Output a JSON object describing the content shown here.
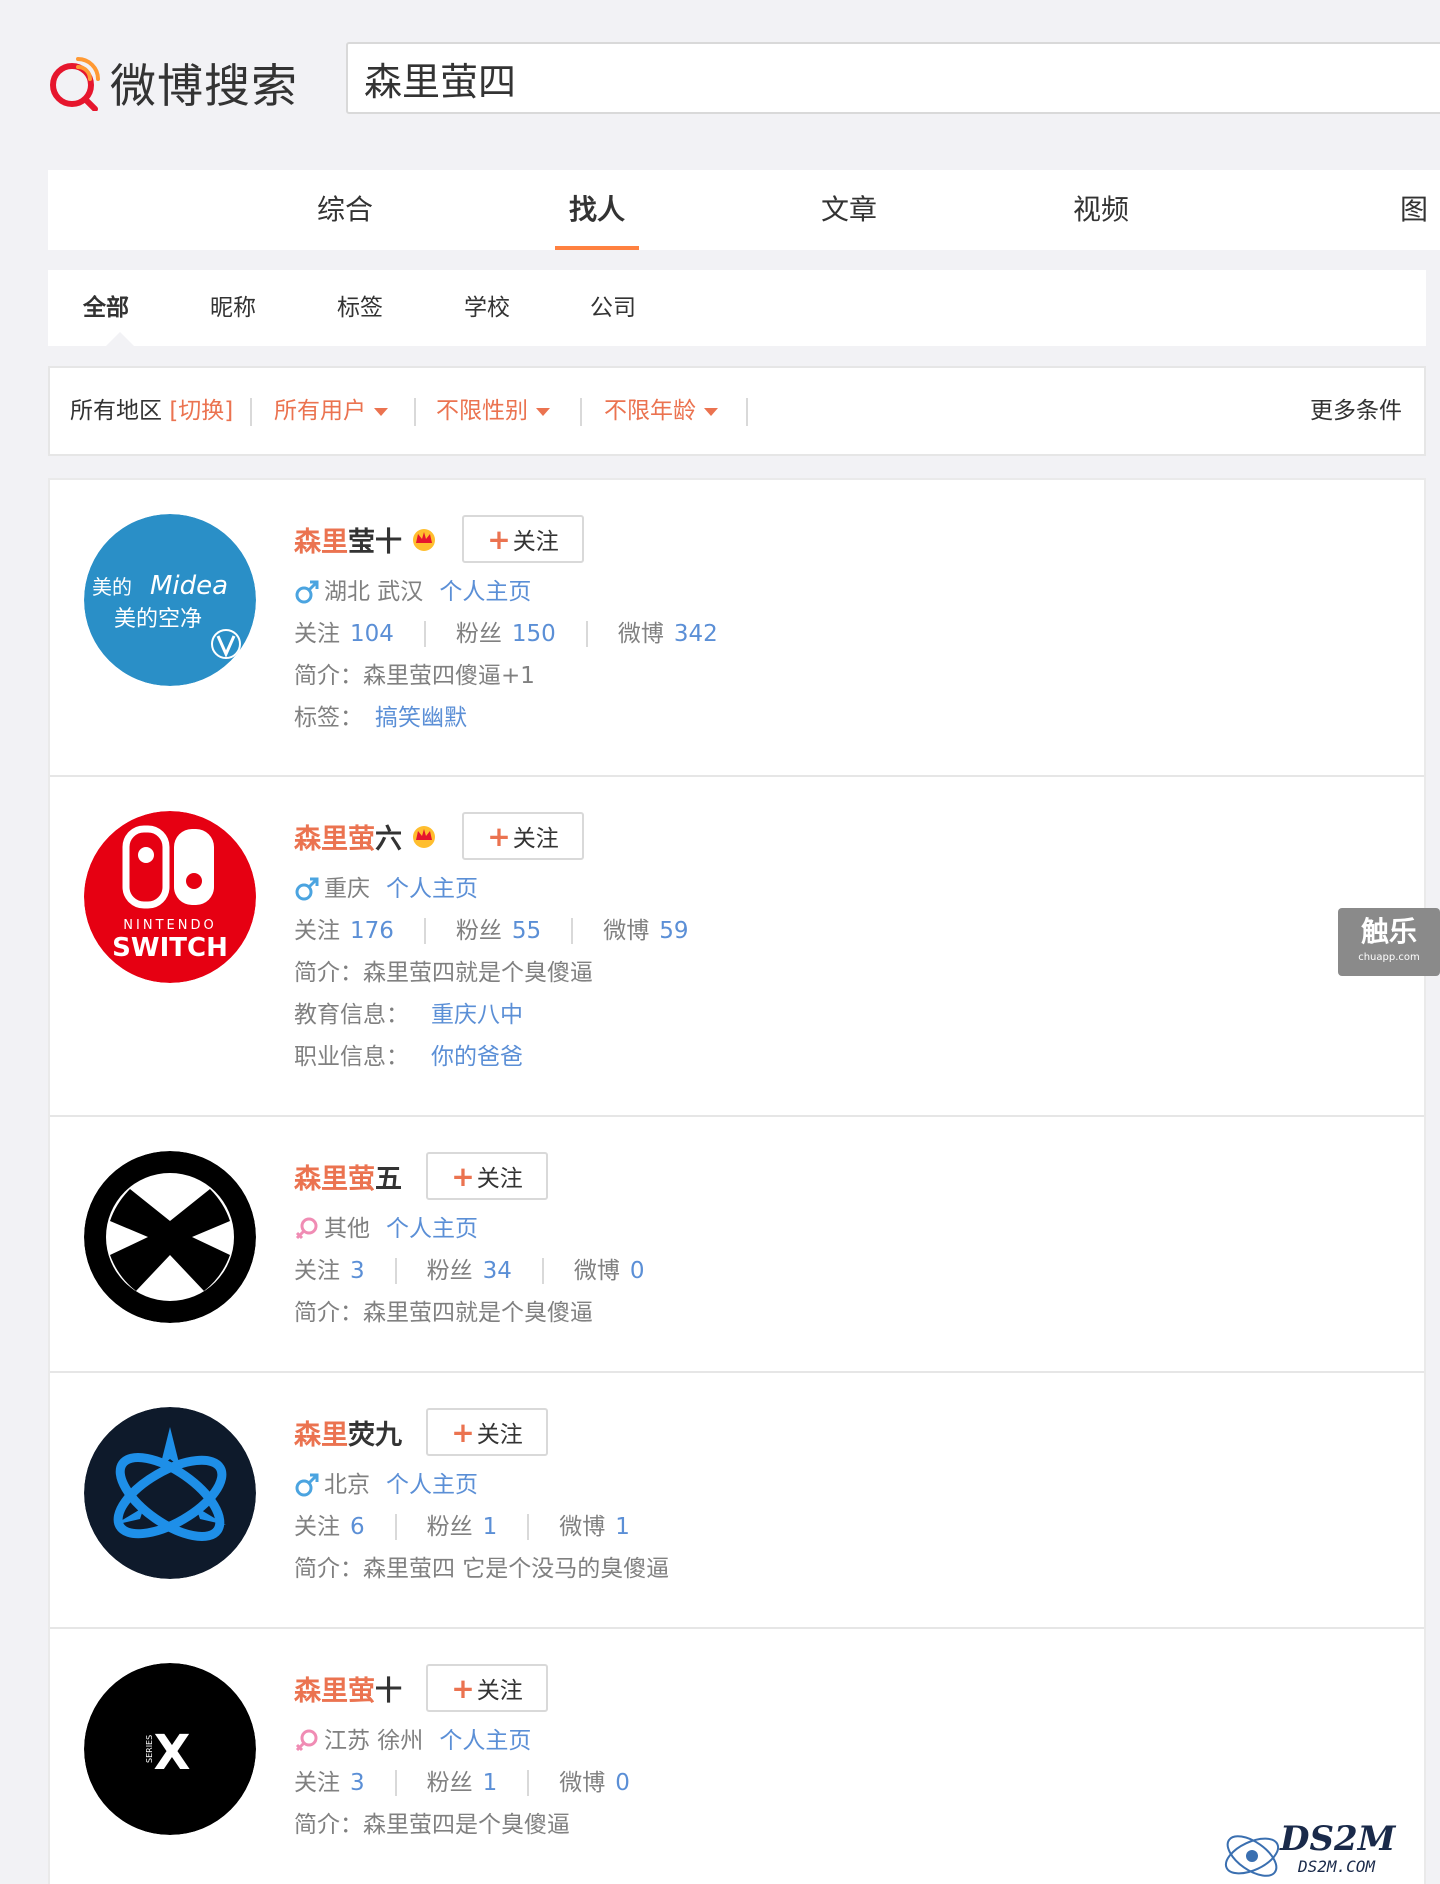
{
  "header": {
    "logo_text": "微博搜索",
    "search_value": "森里萤四"
  },
  "tabs": [
    {
      "label": "综合"
    },
    {
      "label": "找人"
    },
    {
      "label": "文章"
    },
    {
      "label": "视频"
    },
    {
      "label": "图"
    }
  ],
  "subtabs": [
    {
      "label": "全部"
    },
    {
      "label": "昵称"
    },
    {
      "label": "标签"
    },
    {
      "label": "学校"
    },
    {
      "label": "公司"
    }
  ],
  "filter": {
    "region_label": "所有地区",
    "region_switch": "[切换]",
    "user_type": "所有用户",
    "gender": "不限性别",
    "age": "不限年龄",
    "more": "更多条件"
  },
  "follow_label": "关注",
  "homepage_label": "个人主页",
  "stats_labels": {
    "following": "关注",
    "fans": "粉丝",
    "weibo": "微博"
  },
  "labels": {
    "intro": "简介：",
    "tags": "标签：",
    "edu": "教育信息：",
    "job": "职业信息："
  },
  "users": [
    {
      "name_hl": "森里",
      "name_rest": "莹十",
      "location": "湖北 武汉",
      "following": "104",
      "fans": "150",
      "weibo": "342",
      "intro": "森里萤四傻逼+1",
      "tag": "搞笑幽默",
      "avatar_text1": "美的",
      "avatar_text2": "Midea",
      "avatar_text3": "美的空净"
    },
    {
      "name_hl": "森里萤",
      "name_rest": "六",
      "location": "重庆",
      "following": "176",
      "fans": "55",
      "weibo": "59",
      "intro": "森里萤四就是个臭傻逼",
      "edu": "重庆八中",
      "job": "你的爸爸",
      "avatar_text1": "NINTENDO",
      "avatar_text2": "SWITCH"
    },
    {
      "name_hl": "森里萤",
      "name_rest": "五",
      "location": "其他",
      "following": "3",
      "fans": "34",
      "weibo": "0",
      "intro": "森里萤四就是个臭傻逼"
    },
    {
      "name_hl": "森里",
      "name_rest": "荧九",
      "location": "北京",
      "following": "6",
      "fans": "1",
      "weibo": "1",
      "intro": "森里萤四 它是个没马的臭傻逼"
    },
    {
      "name_hl": "森里萤",
      "name_rest": "十",
      "location": "江苏 徐州",
      "following": "3",
      "fans": "1",
      "weibo": "0",
      "intro": "森里萤四是个臭傻逼",
      "avatar_text1": "SERIES",
      "avatar_text2": "X"
    }
  ],
  "side_widget": {
    "title": "触乐",
    "sub": "chuapp.com"
  },
  "watermark": {
    "title": "DS2M",
    "sub": "DS2M.COM"
  },
  "colors": {
    "accent": "#eb7350",
    "link": "#5b8fd6",
    "tab_underline": "#ff8140"
  }
}
